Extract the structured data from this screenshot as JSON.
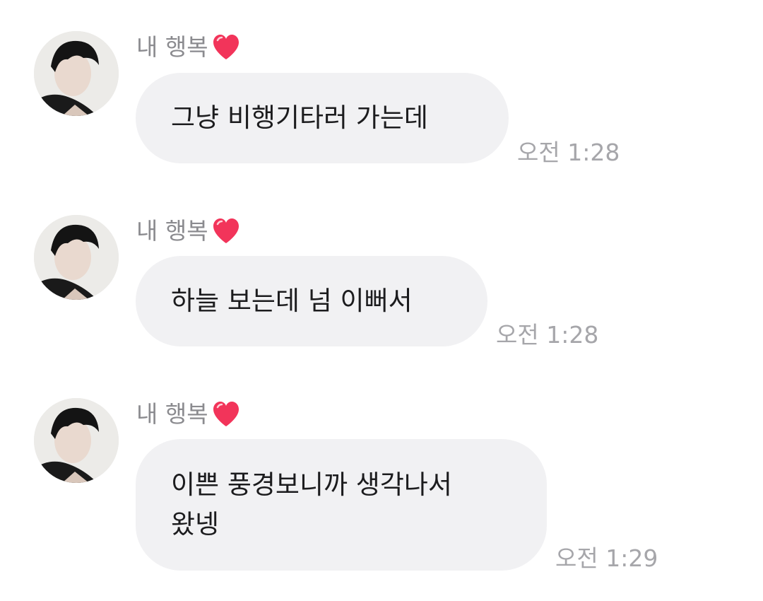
{
  "messages": [
    {
      "sender": "내 행복",
      "heart_icon": "heart-emoji",
      "text": "그냥 비행기타러 가는데",
      "time": "오전 1:28"
    },
    {
      "sender": "내 행복",
      "heart_icon": "heart-emoji",
      "text": "하늘 보는데 넘 이뻐서",
      "time": "오전 1:28"
    },
    {
      "sender": "내 행복",
      "heart_icon": "heart-emoji",
      "text": "이쁜 풍경보니까 생각나서\n왔넹",
      "time": "오전 1:29"
    }
  ],
  "colors": {
    "bubble": "#f1f1f3",
    "sender_text": "#8b8b8f",
    "time_text": "#a6a6aa",
    "message_text": "#1c1c1e",
    "heart": "#f2345a"
  }
}
